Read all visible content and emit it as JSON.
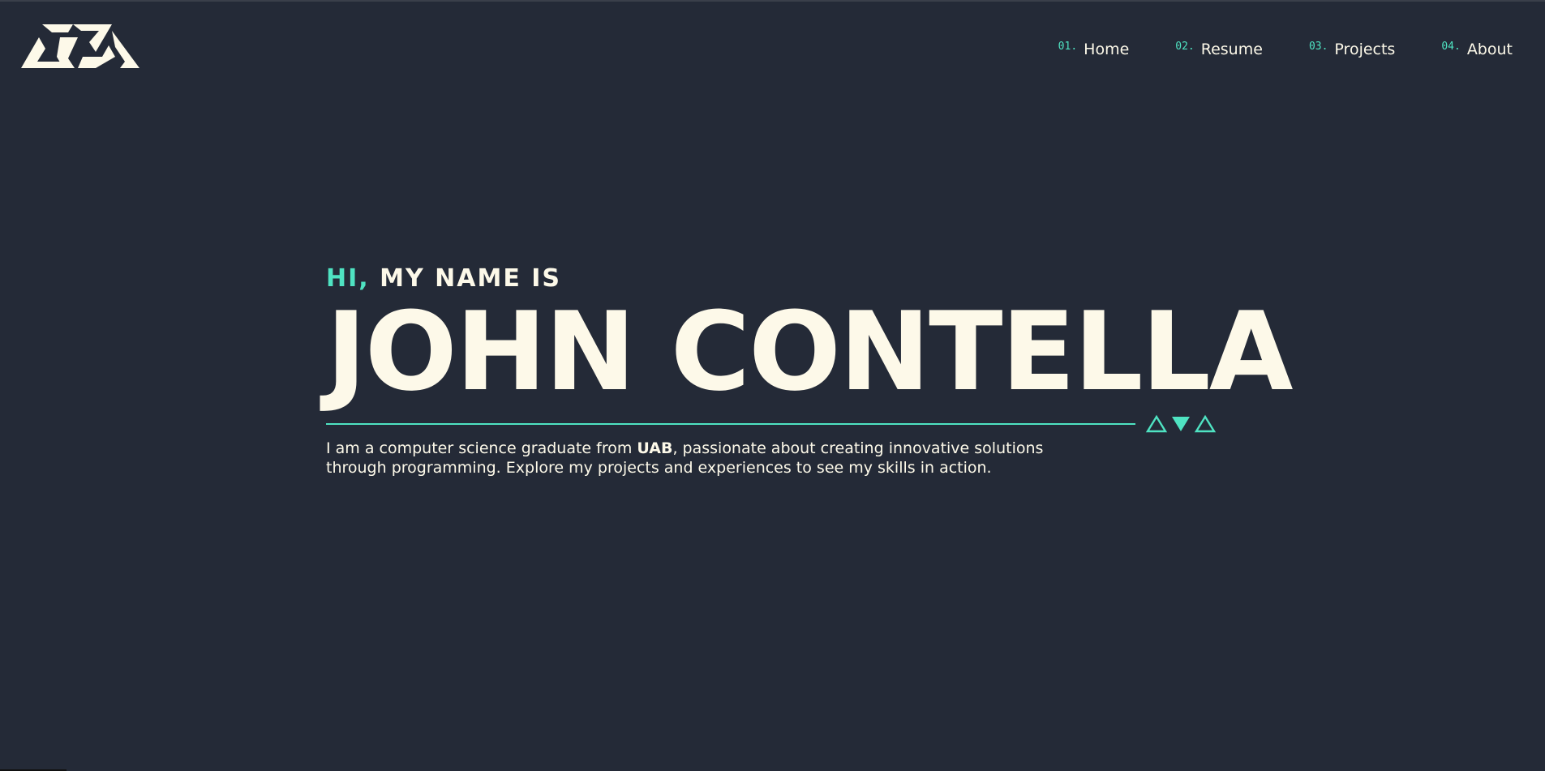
{
  "brand": {
    "logo_icon": "jc-triangle-monogram-icon"
  },
  "nav": {
    "items": [
      {
        "num": "01.",
        "label": "Home"
      },
      {
        "num": "02.",
        "label": "Resume"
      },
      {
        "num": "03.",
        "label": "Projects"
      },
      {
        "num": "04.",
        "label": "About"
      }
    ]
  },
  "hero": {
    "greeting_accent": "HI,",
    "greeting_rest": "MY NAME IS",
    "name": "JOHN CONTELLA",
    "bio_part1": "I am a computer science graduate from ",
    "bio_bold": "UAB",
    "bio_part2": ", passionate about creating innovative solutions through programming. Explore my projects and experiences to see my skills in action."
  },
  "colors": {
    "background": "#242a37",
    "accent": "#4fe3c2",
    "text": "#fdf9e9"
  }
}
